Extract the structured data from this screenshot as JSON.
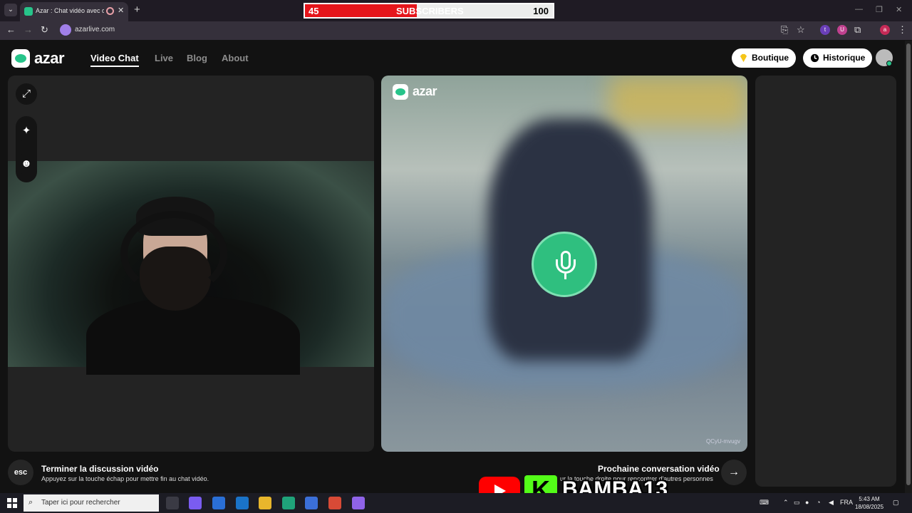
{
  "browser": {
    "tab_title": "Azar : Chat vidéo avec de n",
    "tab_close": "✕",
    "new_tab": "+",
    "url": "azarlive.com",
    "extensions": [
      "t",
      "U",
      "a"
    ]
  },
  "subscribers_bar": {
    "current": "45",
    "label": "SUBSCRIBERS",
    "goal": "100",
    "progress_fraction": 0.45,
    "fill_color": "#e5151b"
  },
  "header": {
    "logo_text": "azar",
    "nav": [
      {
        "label": "Video Chat",
        "active": true
      },
      {
        "label": "Live",
        "active": false
      },
      {
        "label": "Blog",
        "active": false
      },
      {
        "label": "About",
        "active": false
      }
    ],
    "boutique_label": "Boutique",
    "historique_label": "Historique"
  },
  "peer": {
    "logo_text": "azar",
    "code": "QCyU-mvugv"
  },
  "bottom": {
    "esc_key": "esc",
    "end_title": "Terminer la discussion vidéo",
    "end_sub": "Appuyez sur la touche échap pour mettre fin au chat vidéo.",
    "next_title": "Prochaine conversation vidéo",
    "next_sub": "ur la touche droite pour rencontrer d'autres personnes"
  },
  "overlay": {
    "kick_letter": "K",
    "channel": "BAMBA13"
  },
  "taskbar": {
    "search_placeholder": "Taper ici pour rechercher",
    "language": "FRA",
    "time": "5:43 AM",
    "date": "18/08/2025"
  },
  "colors": {
    "accent": "#27c48a",
    "mic_green": "#2fbf7f",
    "youtube_red": "#ff0000",
    "kick_green": "#53fc18"
  }
}
